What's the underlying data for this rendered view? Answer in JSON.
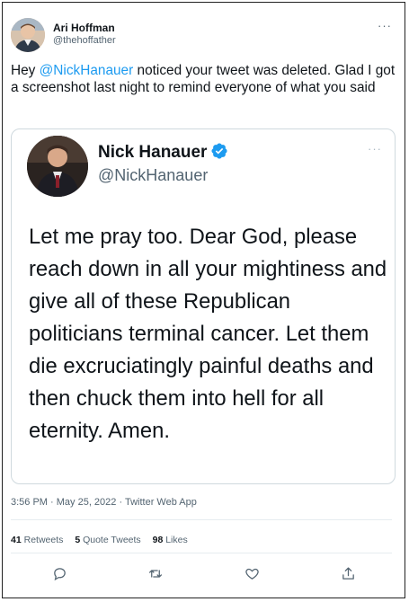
{
  "tweet": {
    "author_name": "Ari Hoffman",
    "author_handle": "@thehoffather",
    "more_label": "···",
    "text_before": "Hey ",
    "mention": "@NickHanauer",
    "text_after": " noticed your tweet was deleted. Glad I got a screenshot last night to remind everyone of what you said"
  },
  "quoted": {
    "author_name": "Nick Hanauer",
    "author_handle": "@NickHanauer",
    "more_label": "···",
    "text": "Let me pray too.  Dear God, please reach down in all your mightiness and give all of these Republican politicians terminal cancer. Let them die excruciatingly painful deaths and then chuck them into hell for all eternity.  Amen."
  },
  "meta": "3:56 PM · May 25, 2022 · Twitter Web App",
  "stats": {
    "retweets_count": "41",
    "retweets_label": "Retweets",
    "quotes_count": "5",
    "quotes_label": "Quote Tweets",
    "likes_count": "98",
    "likes_label": "Likes"
  },
  "actions": {
    "reply_icon": "reply-icon",
    "retweet_icon": "retweet-icon",
    "like_icon": "like-icon",
    "share_icon": "share-icon"
  },
  "colors": {
    "accent": "#1d9bf0",
    "secondary_text": "#536471",
    "border": "#cfd9de"
  }
}
